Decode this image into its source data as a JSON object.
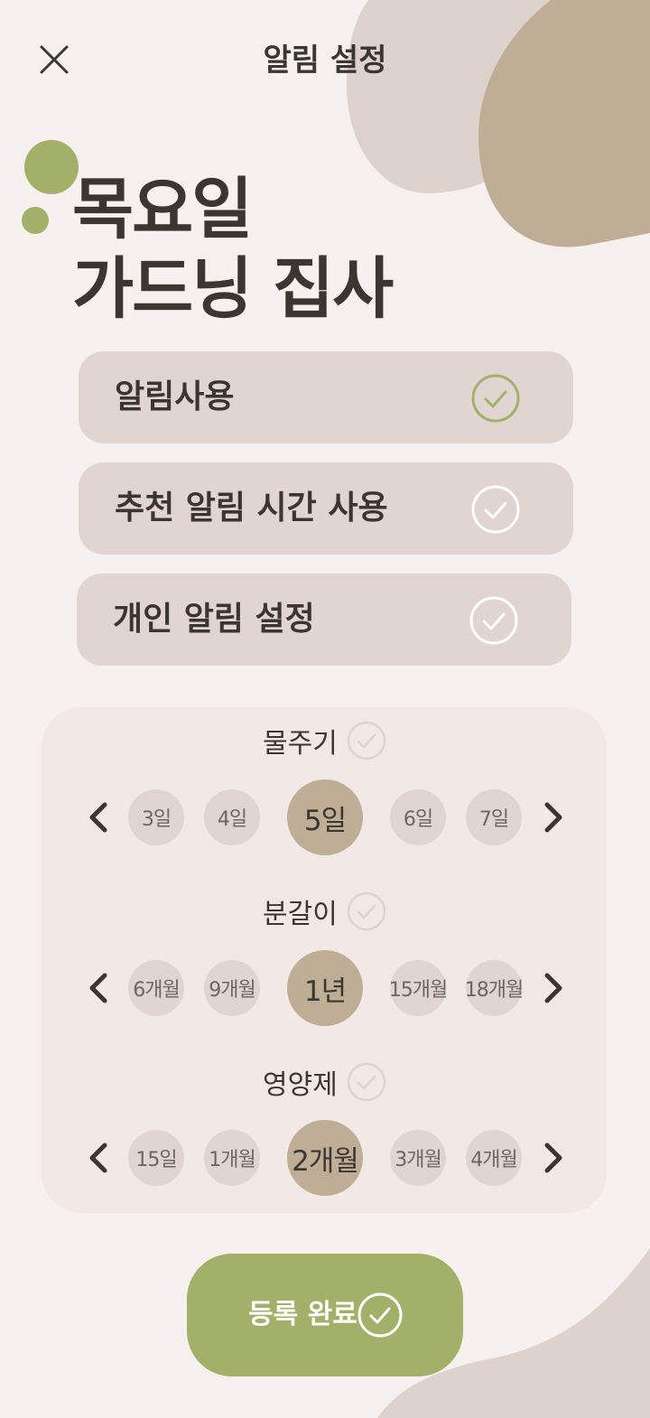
{
  "header": {
    "title": "알림 설정"
  },
  "plant": {
    "name_line1": "목요일",
    "name_line2": "가드닝 집사"
  },
  "options": [
    {
      "label": "알림사용",
      "checked": true
    },
    {
      "label": "추천 알림 시간 사용",
      "checked": false
    },
    {
      "label": "개인 알림 설정",
      "checked": false
    }
  ],
  "schedules": [
    {
      "title": "물주기",
      "values": [
        "3일",
        "4일",
        "5일",
        "6일",
        "7일"
      ],
      "selected": "5일"
    },
    {
      "title": "분갈이",
      "values": [
        "6개월",
        "9개월",
        "1년",
        "15개월",
        "18개월"
      ],
      "selected": "1년"
    },
    {
      "title": "영양제",
      "values": [
        "15일",
        "1개월",
        "2개월",
        "3개월",
        "4개월"
      ],
      "selected": "2개월"
    }
  ],
  "submit": {
    "label": "등록 완료"
  },
  "colors": {
    "background": "#f6f1ee",
    "accent_green": "#a3b06a",
    "blob_tan": "#bfad96",
    "blob_light": "#ddd2cc",
    "option_bg": "#e0d5d0",
    "selected_pill": "#bfad96",
    "text_dark": "#3b3631"
  },
  "icons": {
    "close": "close-icon",
    "check": "check-circle-icon",
    "prev": "chevron-left-icon",
    "next": "chevron-right-icon"
  }
}
